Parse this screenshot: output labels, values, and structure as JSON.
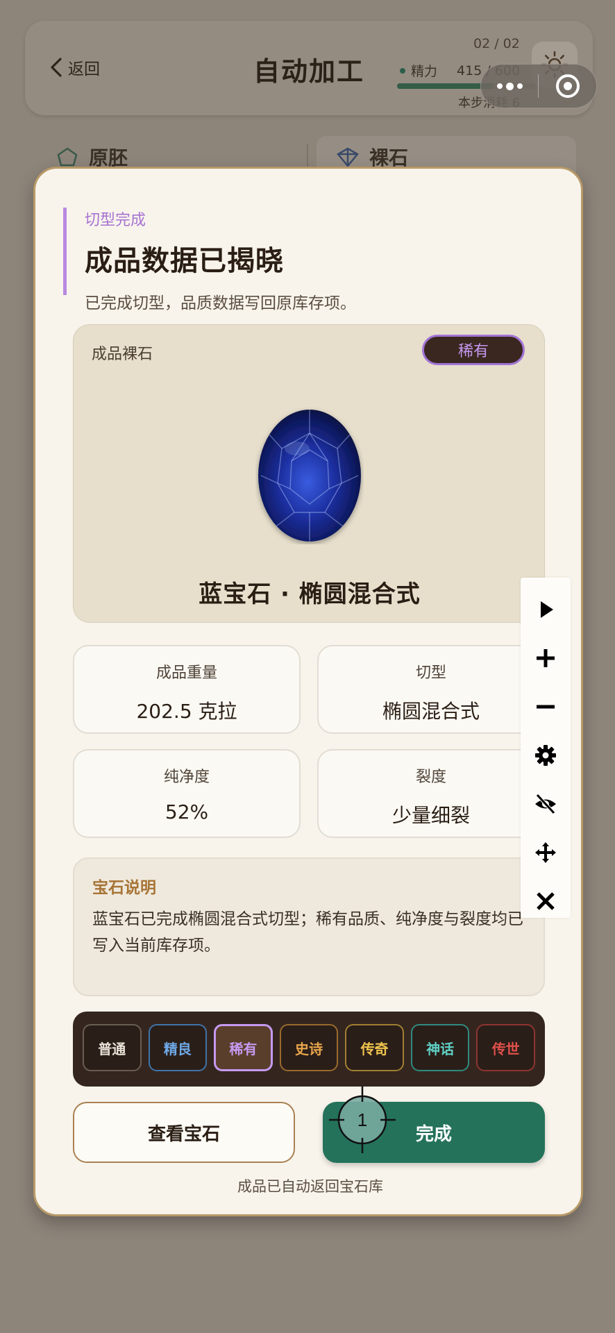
{
  "header": {
    "back_label": "返回",
    "title": "自动加工",
    "step_counter": "02 / 02",
    "energy_label": "精力",
    "energy_value": "415 / 600",
    "energy_fraction": 0.69,
    "step_cost": "本步消耗 6"
  },
  "tabs": [
    {
      "label": "原胚",
      "icon": "rough-gem-icon"
    },
    {
      "label": "裸石",
      "icon": "cut-gem-icon"
    }
  ],
  "modal": {
    "kicker": "切型完成",
    "title": "成品数据已揭晓",
    "subtitle": "已完成切型，品质数据写回原库存项。",
    "gem_card": {
      "label": "成品裸石",
      "rarity_badge": "稀有",
      "gem_name": "蓝宝石 · 椭圆混合式"
    },
    "stats": [
      {
        "label": "成品重量",
        "value": "202.5 克拉"
      },
      {
        "label": "切型",
        "value": "椭圆混合式"
      },
      {
        "label": "纯净度",
        "value": "52%"
      },
      {
        "label": "裂度",
        "value": "少量细裂"
      }
    ],
    "description": {
      "title": "宝石说明",
      "body": "蓝宝石已完成椭圆混合式切型；稀有品质、纯净度与裂度均已写入当前库存项。"
    },
    "rarity_levels": [
      {
        "label": "普通",
        "color": "#e8e2d6",
        "border": "#6a5d52",
        "selected": false
      },
      {
        "label": "精良",
        "color": "#6ea8e6",
        "border": "#3f73a8",
        "selected": false
      },
      {
        "label": "稀有",
        "color": "#c59af0",
        "border": "#a374d6",
        "selected": true
      },
      {
        "label": "史诗",
        "color": "#e8a64c",
        "border": "#9a6a2c",
        "selected": false
      },
      {
        "label": "传奇",
        "color": "#f0c44e",
        "border": "#a08030",
        "selected": false
      },
      {
        "label": "神话",
        "color": "#5fd0c4",
        "border": "#2f8a80",
        "selected": false
      },
      {
        "label": "传世",
        "color": "#e0504a",
        "border": "#8f3430",
        "selected": false
      }
    ],
    "view_button": "查看宝石",
    "done_button": "完成",
    "footnote": "成品已自动返回宝石库"
  },
  "overlay": {
    "crosshair_label": "1"
  },
  "toolbar": [
    "play-icon",
    "zoom-in-icon",
    "zoom-out-icon",
    "settings-icon",
    "hide-icon",
    "move-icon",
    "close-icon"
  ],
  "colors": {
    "accent_green": "#24725a",
    "rare_purple": "#a374d6",
    "gem_blue": "#1a2f9c"
  }
}
